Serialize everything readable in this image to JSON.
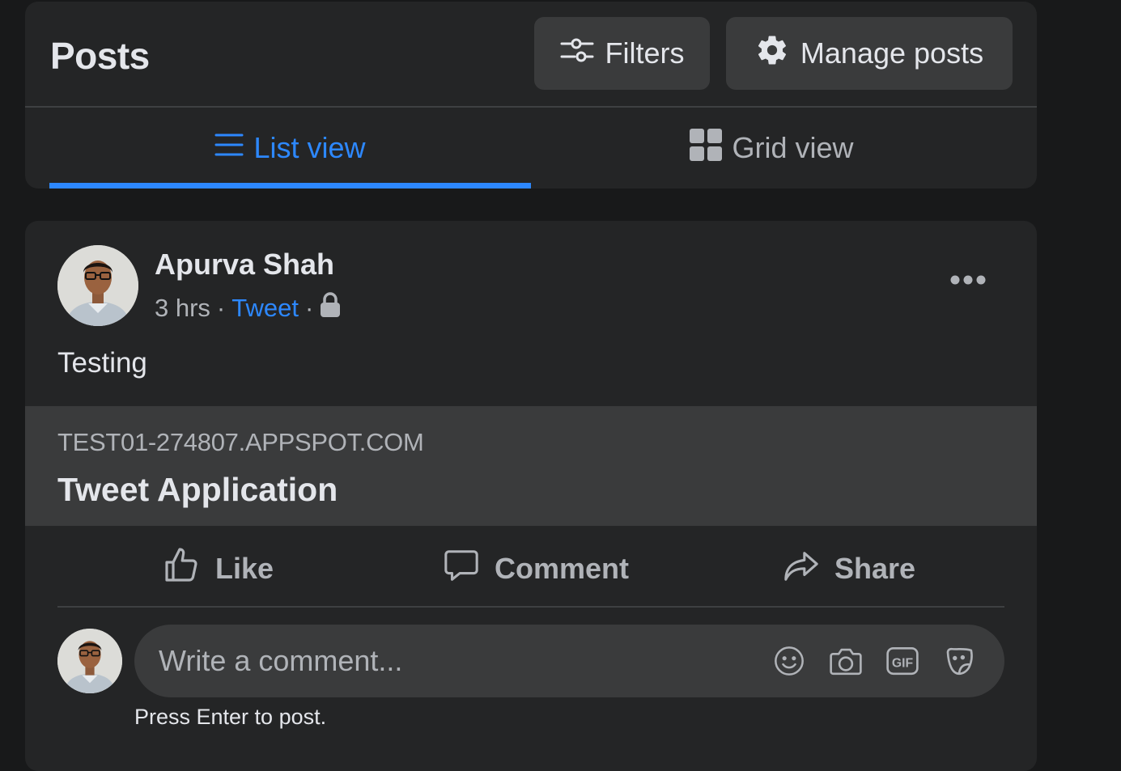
{
  "header": {
    "title": "Posts",
    "filters_label": "Filters",
    "manage_label": "Manage posts",
    "tabs": [
      {
        "label": "List view",
        "active": true
      },
      {
        "label": "Grid view",
        "active": false
      }
    ]
  },
  "post": {
    "author": "Apurva Shah",
    "time": "3 hrs",
    "separator": "·",
    "app_link": "Tweet",
    "privacy_icon": "lock-icon",
    "text": "Testing",
    "link_preview": {
      "domain": "TEST01-274807.APPSPOT.COM",
      "title": "Tweet Application"
    },
    "actions": {
      "like": "Like",
      "comment": "Comment",
      "share": "Share"
    },
    "comment_box": {
      "placeholder": "Write a comment...",
      "hint": "Press Enter to post.",
      "icons": [
        "emoji-icon",
        "camera-icon",
        "gif-icon",
        "sticker-icon"
      ]
    }
  },
  "colors": {
    "background": "#18191a",
    "card": "#242526",
    "button": "#3a3b3c",
    "accent": "#2d88ff",
    "text_primary": "#e4e6eb",
    "text_secondary": "#b0b3b8"
  }
}
